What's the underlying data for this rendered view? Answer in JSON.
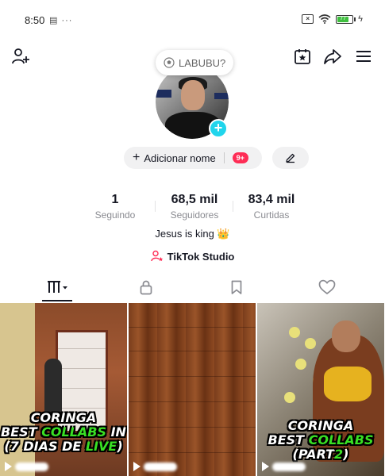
{
  "status_bar": {
    "time": "8:50",
    "left_icons": "▤ ···",
    "battery_level": "77",
    "battery_color": "#3fbf3f"
  },
  "header": {
    "left_icon": "add-friend-icon",
    "right_icons": [
      "calendar-star-icon",
      "share-icon",
      "menu-icon"
    ]
  },
  "note": {
    "icon": "soccer-ball-icon",
    "text": "LABUBU?"
  },
  "profile": {
    "add_name_label": "Adicionar nome",
    "badge": "9+",
    "edit_icon": "pencil-icon"
  },
  "stats": [
    {
      "value": "1",
      "label": "Seguindo"
    },
    {
      "value": "68,5 mil",
      "label": "Seguidores"
    },
    {
      "value": "83,4 mil",
      "label": "Curtidas"
    }
  ],
  "bio": "Jesus is king 👑",
  "studio_label": "TikTok Studio",
  "tabs": [
    {
      "icon": "grid-videos-icon",
      "active": true
    },
    {
      "icon": "lock-icon",
      "active": false
    },
    {
      "icon": "bookmark-icon",
      "active": false
    },
    {
      "icon": "heart-icon",
      "active": false
    }
  ],
  "videos": [
    {
      "caption_line1": "CORINGA",
      "caption_line2_a": "BEST ",
      "caption_line2_b": "COLLABS",
      "caption_line2_c": " IN",
      "caption_line3_a": "(7 DIAS DE ",
      "caption_line3_b": "LIVE",
      "caption_line3_c": ")"
    },
    {},
    {
      "caption_line1": "CORINGA",
      "caption_line2_a": "BEST ",
      "caption_line2_b": "COLLABS",
      "caption_line3_a": "(PART",
      "caption_line3_b": "2",
      "caption_line3_c": ")"
    }
  ],
  "colors": {
    "accent": "#fe2c55",
    "avatar_add": "#20d5ec",
    "caption_highlight": "#39e024"
  }
}
